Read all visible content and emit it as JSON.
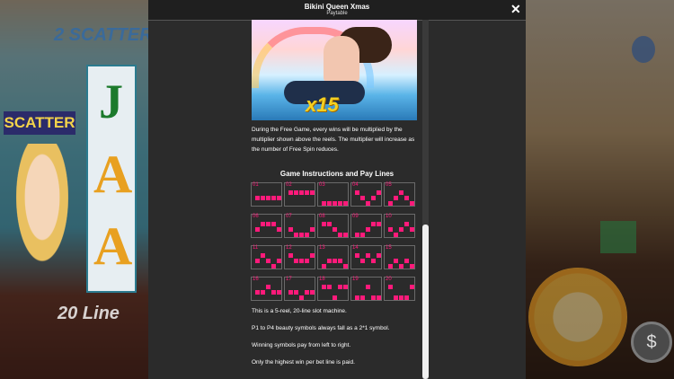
{
  "window": {
    "title": "Bikini Queen Xmas",
    "subtitle": "Paytable",
    "close_symbol": "✕"
  },
  "game_bg": {
    "left_top_banner": "2 SCATTER",
    "scatter_label": "SCATTER",
    "reel_symbols": [
      "J",
      "A",
      "A"
    ],
    "left_bottom_banner": "20 Line",
    "chip_symbol": "$"
  },
  "promo": {
    "multiplier_text": "x15"
  },
  "free_game_description": "During the Free Game, every wins will be multiplied by the multiplier shown above the reels. The multiplier will increase as the number of Free Spin reduces.",
  "section_title": "Game Instructions and Pay Lines",
  "paylines": [
    {
      "number": "01",
      "rows": [
        1,
        1,
        1,
        1,
        1
      ]
    },
    {
      "number": "02",
      "rows": [
        0,
        0,
        0,
        0,
        0
      ]
    },
    {
      "number": "03",
      "rows": [
        2,
        2,
        2,
        2,
        2
      ]
    },
    {
      "number": "04",
      "rows": [
        0,
        1,
        2,
        1,
        0
      ]
    },
    {
      "number": "05",
      "rows": [
        2,
        1,
        0,
        1,
        2
      ]
    },
    {
      "number": "06",
      "rows": [
        1,
        0,
        0,
        0,
        1
      ]
    },
    {
      "number": "07",
      "rows": [
        1,
        2,
        2,
        2,
        1
      ]
    },
    {
      "number": "08",
      "rows": [
        0,
        0,
        1,
        2,
        2
      ]
    },
    {
      "number": "09",
      "rows": [
        2,
        2,
        1,
        0,
        0
      ]
    },
    {
      "number": "10",
      "rows": [
        1,
        2,
        1,
        0,
        1
      ]
    },
    {
      "number": "11",
      "rows": [
        1,
        0,
        1,
        2,
        1
      ]
    },
    {
      "number": "12",
      "rows": [
        0,
        1,
        1,
        1,
        0
      ]
    },
    {
      "number": "13",
      "rows": [
        2,
        1,
        1,
        1,
        2
      ]
    },
    {
      "number": "14",
      "rows": [
        0,
        1,
        0,
        1,
        0
      ]
    },
    {
      "number": "15",
      "rows": [
        2,
        1,
        2,
        1,
        2
      ]
    },
    {
      "number": "16",
      "rows": [
        1,
        1,
        0,
        1,
        1
      ]
    },
    {
      "number": "17",
      "rows": [
        1,
        1,
        2,
        1,
        1
      ]
    },
    {
      "number": "18",
      "rows": [
        0,
        0,
        2,
        0,
        0
      ]
    },
    {
      "number": "19",
      "rows": [
        2,
        2,
        0,
        2,
        2
      ]
    },
    {
      "number": "20",
      "rows": [
        0,
        2,
        2,
        2,
        0
      ]
    }
  ],
  "info_lines": [
    "This is a 5-reel, 20-line slot machine.",
    "P1 to P4 beauty symbols always fall as a 2*1 symbol.",
    "Winning symbols pay from left to right.",
    "Only the highest win per bet line is paid."
  ],
  "colors": {
    "accent": "#ff1a7a",
    "panel_bg": "#2b2b2b"
  }
}
